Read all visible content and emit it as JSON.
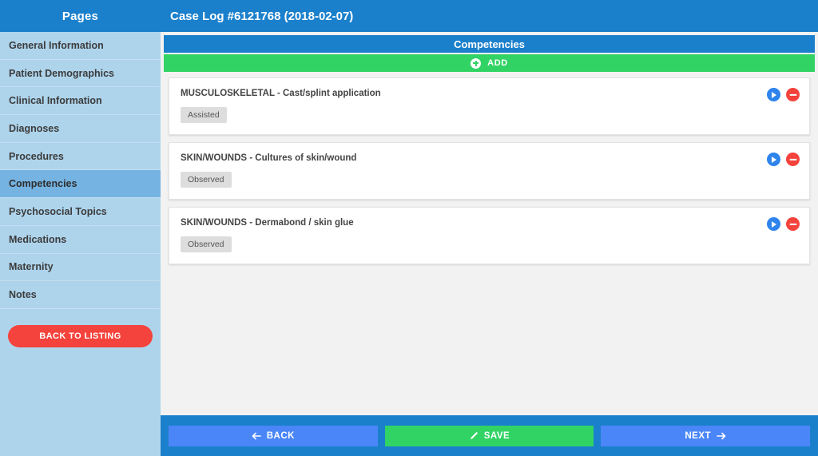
{
  "sidebar": {
    "header_title": "Pages",
    "items": [
      {
        "label": "General Information",
        "active": false
      },
      {
        "label": "Patient Demographics",
        "active": false
      },
      {
        "label": "Clinical Information",
        "active": false
      },
      {
        "label": "Diagnoses",
        "active": false
      },
      {
        "label": "Procedures",
        "active": false
      },
      {
        "label": "Competencies",
        "active": true
      },
      {
        "label": "Psychosocial Topics",
        "active": false
      },
      {
        "label": "Medications",
        "active": false
      },
      {
        "label": "Maternity",
        "active": false
      },
      {
        "label": "Notes",
        "active": false
      }
    ],
    "back_to_listing_label": "BACK TO LISTING"
  },
  "header": {
    "title": "Case Log #6121768 (2018-02-07)"
  },
  "section": {
    "title": "Competencies",
    "add_label": "ADD",
    "add_icon": "plus-circle-icon"
  },
  "competencies": [
    {
      "title": "MUSCULOSKELETAL - Cast/splint application",
      "badge": "Assisted",
      "play_icon": "play-circle-icon",
      "remove_icon": "minus-circle-icon"
    },
    {
      "title": "SKIN/WOUNDS - Cultures of skin/wound",
      "badge": "Observed",
      "play_icon": "play-circle-icon",
      "remove_icon": "minus-circle-icon"
    },
    {
      "title": "SKIN/WOUNDS - Dermabond / skin glue",
      "badge": "Observed",
      "play_icon": "play-circle-icon",
      "remove_icon": "minus-circle-icon"
    }
  ],
  "footer": {
    "back_label": "BACK",
    "back_icon": "arrow-left-icon",
    "save_label": "SAVE",
    "save_icon": "pencil-icon",
    "next_label": "NEXT",
    "next_icon": "arrow-right-icon"
  },
  "colors": {
    "header_blue": "#1b80cc",
    "sidebar_blue": "#aed4ec",
    "sidebar_active": "#75b3e2",
    "green": "#32d365",
    "red": "#f4433c",
    "button_blue": "#4a86f7",
    "page_gray": "#f2f2f2"
  }
}
